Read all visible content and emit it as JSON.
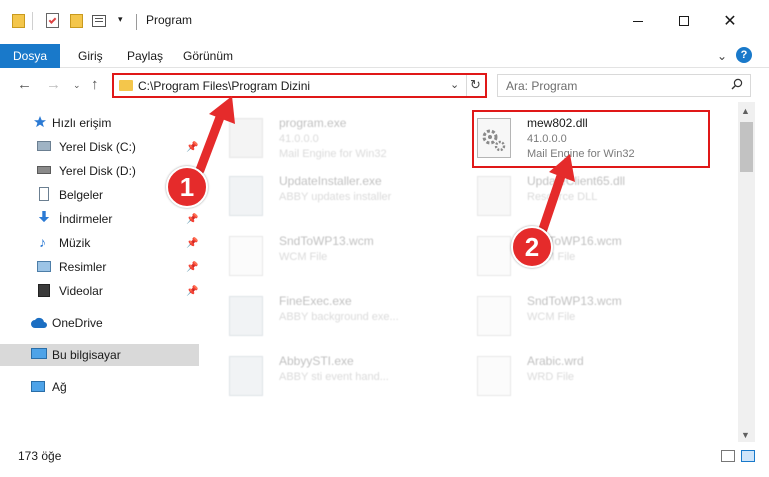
{
  "window": {
    "title": "Program"
  },
  "ribbon": {
    "tabs": [
      "Dosya",
      "Giriş",
      "Paylaş",
      "Görünüm"
    ]
  },
  "nav": {
    "address": "C:\\Program Files\\Program Dizini",
    "search_placeholder": "Ara: Program"
  },
  "sidebar": {
    "items": [
      {
        "label": "Hızlı erişim"
      },
      {
        "label": "Yerel Disk (C:)"
      },
      {
        "label": "Yerel Disk (D:)"
      },
      {
        "label": "Belgeler"
      },
      {
        "label": "İndirmeler"
      },
      {
        "label": "Müzik"
      },
      {
        "label": "Resimler"
      },
      {
        "label": "Videolar"
      },
      {
        "label": "OneDrive"
      },
      {
        "label": "Bu bilgisayar"
      },
      {
        "label": "Ağ"
      }
    ]
  },
  "files": [
    {
      "name": "program.exe",
      "line2": "41.0.0.0",
      "line3": "Mail Engine for Win32"
    },
    {
      "name": "mew802.dll",
      "line2": "41.0.0.0",
      "line3": "Mail Engine for Win32"
    },
    {
      "name": "UpdateInstaller.exe",
      "line2": "ABBY updates installer",
      "line3": ""
    },
    {
      "name": "UpdateClient65.dll",
      "line2": "Resource DLL",
      "line3": ""
    },
    {
      "name": "SndToWP13.wcm",
      "line2": "WCM File",
      "line3": ""
    },
    {
      "name": "SndToWP16.wcm",
      "line2": "WCM File",
      "line3": ""
    },
    {
      "name": "FineExec.exe",
      "line2": "ABBY background exe...",
      "line3": ""
    },
    {
      "name": "SndToWP13.wcm",
      "line2": "WCM File",
      "line3": ""
    },
    {
      "name": "AbbyySTI.exe",
      "line2": "ABBY sti event hand...",
      "line3": ""
    },
    {
      "name": "Arabic.wrd",
      "line2": "WRD File",
      "line3": ""
    }
  ],
  "status": {
    "count": "173 öğe"
  },
  "callouts": [
    "1",
    "2"
  ],
  "colors": {
    "accent": "#1979ca",
    "highlight": "#e01818",
    "callout": "#e52b2b"
  }
}
